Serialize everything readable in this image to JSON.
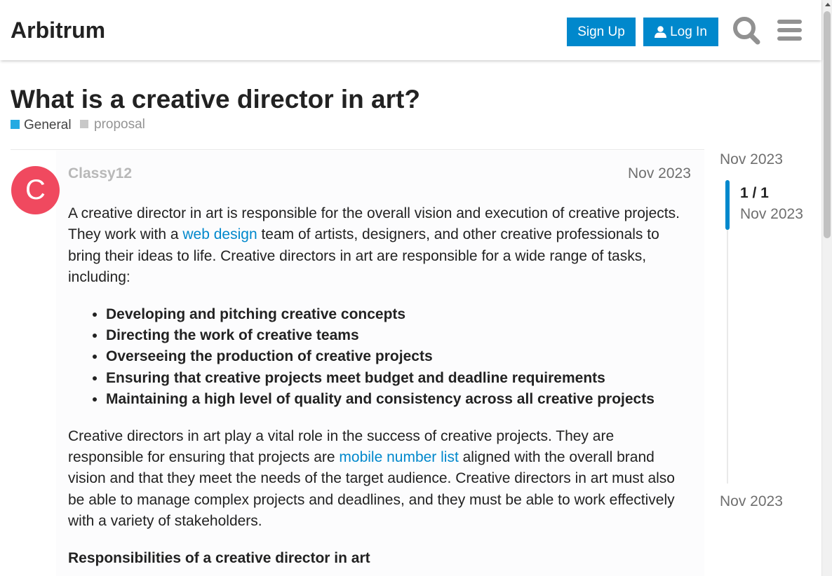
{
  "header": {
    "site_title": "Arbitrum",
    "signup_label": "Sign Up",
    "login_label": "Log In"
  },
  "topic": {
    "title": "What is a creative director in art?",
    "category": "General",
    "tag": "proposal"
  },
  "post": {
    "avatar_letter": "C",
    "username": "Classy12",
    "date": "Nov 2023",
    "p1_before_link": "A creative director in art is responsible for the overall vision and execution of creative projects. They work with a ",
    "p1_link": "web design",
    "p1_after_link": " team of artists, designers, and other creative professionals to bring their ideas to life. Creative directors in art are responsible for a wide range of tasks, including:",
    "list_items": [
      "Developing and pitching creative concepts",
      "Directing the work of creative teams",
      "Overseeing the production of creative projects",
      "Ensuring that creative projects meet budget and deadline requirements",
      "Maintaining a high level of quality and consistency across all creative projects"
    ],
    "p2_before_link": "Creative directors in art play a vital role in the success of creative projects. They are responsible for ensuring that projects are ",
    "p2_link": "mobile number list",
    "p2_after_link": " aligned with the overall brand vision and that they meet the needs of the target audience. Creative directors in art must also be able to manage complex projects and deadlines, and they must be able to work effectively with a variety of stakeholders.",
    "subheading": "Responsibilities of a creative director in art"
  },
  "timeline": {
    "top_date": "Nov 2023",
    "position": "1 / 1",
    "position_date": "Nov 2023",
    "bottom_date": "Nov 2023"
  },
  "colors": {
    "accent": "#0088cc",
    "category": "#25aae2",
    "avatar": "#f0495f",
    "tag_square": "#c8c8c8"
  },
  "icons": {
    "search": "search-icon",
    "menu": "hamburger-menu-icon",
    "login": "user-icon"
  }
}
